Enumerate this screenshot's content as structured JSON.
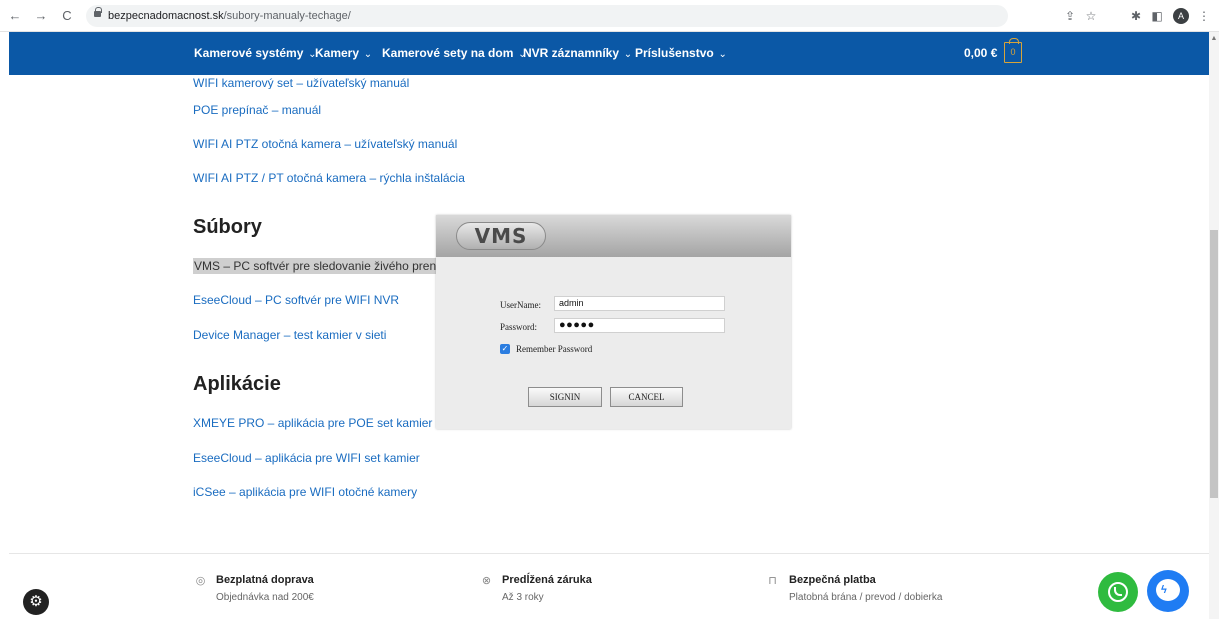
{
  "browser": {
    "back": "←",
    "forward": "→",
    "reload": "C",
    "url_domain": "bezpecnadomacnost.sk",
    "url_path": "/subory-manualy-techage/",
    "share_icon": "share-icon",
    "star_icon": "bookmark-star-icon",
    "extensions_icon": "extensions-puzzle-icon",
    "sidepanel_icon": "side-panel-icon",
    "avatar": "A",
    "menu": "⋮"
  },
  "nav": {
    "items": [
      {
        "label": "Kamerové systémy"
      },
      {
        "label": "Kamery"
      },
      {
        "label": "Kamerové sety na dom"
      },
      {
        "label": "NVR záznamníky"
      },
      {
        "label": "Príslušenstvo"
      }
    ],
    "cart_total": "0,00 €",
    "cart_count": "0"
  },
  "content": {
    "manual_links": [
      {
        "label": "WIFI kamerový set – užívateľský manuál"
      },
      {
        "label": "POE prepínač – manuál"
      },
      {
        "label": "WIFI AI PTZ otočná kamera – užívateľský manuál"
      },
      {
        "label": "WIFI AI PTZ / PT otočná kamera – rýchla inštalácia"
      }
    ],
    "files_heading": "Súbory",
    "file_links": [
      {
        "label": "VMS – PC softvér pre sledovanie živého prenosu"
      },
      {
        "label": "EseeCloud – PC softvér pre WIFI NVR"
      },
      {
        "label": "Device Manager – test kamier v sieti"
      }
    ],
    "apps_heading": "Aplikácie",
    "app_links": [
      {
        "label": "XMEYE PRO – aplikácia pre POE set kamier"
      },
      {
        "label": "EseeCloud – aplikácia pre WIFI set kamier"
      },
      {
        "label": "iCSee – aplikácia pre WIFI otočné kamery"
      }
    ]
  },
  "vms_dialog": {
    "logo": "VMS",
    "username_label": "UserName:",
    "username_value": "admin",
    "password_label": "Password:",
    "password_value": "●●●●●",
    "remember_label": "Remember Password",
    "remember_checked": true,
    "signin_label": "SIGNIN",
    "cancel_label": "CANCEL"
  },
  "footer": {
    "features": [
      {
        "icon": "location-pin-icon",
        "title": "Bezplatná doprava",
        "subtitle": "Objednávka nad 200€"
      },
      {
        "icon": "warranty-badge-icon",
        "title": "Predĺžená záruka",
        "subtitle": "Až 3 roky"
      },
      {
        "icon": "lock-icon",
        "title": "Bezpečná platba",
        "subtitle": "Platobná brána / prevod / dobierka"
      }
    ]
  },
  "colors": {
    "header_bg": "#0b58a6",
    "link": "#1a6cc0",
    "whatsapp": "#2fbb3f",
    "messenger": "#1f7cf3",
    "cart_accent": "#d7a43a"
  }
}
